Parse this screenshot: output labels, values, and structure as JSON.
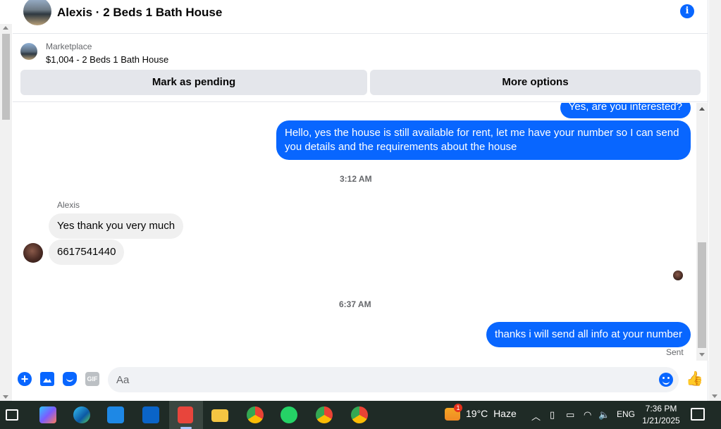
{
  "conversation": {
    "title": "Alexis · 2 Beds 1 Bath House"
  },
  "marketplace": {
    "label": "Marketplace",
    "listing": "$1,004 - 2 Beds 1 Bath House",
    "pending_button": "Mark as pending",
    "more_button": "More options"
  },
  "messages": [
    {
      "direction": "outgoing",
      "text": "Yes, are you interested?"
    },
    {
      "direction": "outgoing",
      "text": "Hello, yes the house is still available for rent, let me have your number so I can send you details and the requirements about the house"
    },
    {
      "direction": "incoming",
      "sender": "Alexis",
      "text": "Yes thank you very much"
    },
    {
      "direction": "incoming",
      "text": "6617541440"
    },
    {
      "direction": "outgoing",
      "text": "thanks i will send all info at your number"
    }
  ],
  "timestamps": [
    "3:12 AM",
    "6:37 AM"
  ],
  "sender_name": "Alexis",
  "sent_status": "Sent",
  "composer": {
    "placeholder": "Aa",
    "gif_label": "GIF"
  },
  "taskbar": {
    "weather_temp": "19°C",
    "weather_desc": "Haze",
    "weather_badge": "1",
    "language": "ENG",
    "time": "7:36 PM",
    "date": "1/21/2025"
  },
  "colors": {
    "accent": "#0866ff",
    "incoming_bubble": "#f0f0f0",
    "taskbar": "#1f2b26"
  }
}
